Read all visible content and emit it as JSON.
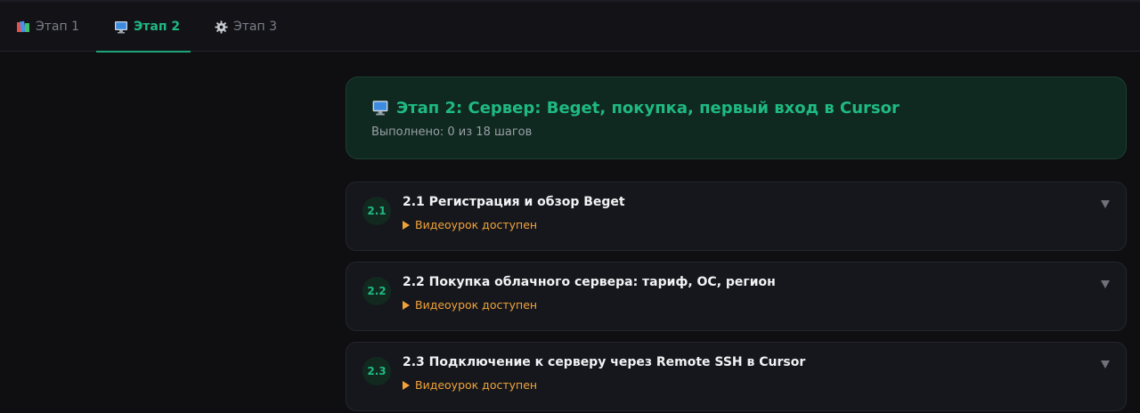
{
  "tabs": [
    {
      "label": "Этап 1",
      "icon": "books-icon",
      "active": false
    },
    {
      "label": "Этап 2",
      "icon": "desktop-computer-icon",
      "active": true
    },
    {
      "label": "Этап 3",
      "icon": "gear-icon",
      "active": false
    }
  ],
  "stage": {
    "title": "Этап 2: Сервер: Beget, покупка, первый вход в Cursor",
    "progress_text": "Выполнено: 0 из 18 шагов",
    "icon": "desktop-computer-icon"
  },
  "steps": [
    {
      "num": "2.1",
      "title": "2.1 Регистрация и обзор Beget",
      "video": "Видеоурок доступен"
    },
    {
      "num": "2.2",
      "title": "2.2 Покупка облачного сервера: тариф, ОС, регион",
      "video": "Видеоурок доступен"
    },
    {
      "num": "2.3",
      "title": "2.3 Подключение к серверу через Remote SSH в Cursor",
      "video": "Видеоурок доступен"
    }
  ],
  "colors": {
    "accent": "#1fb982",
    "video": "#f0a33a",
    "background": "#0f0f12"
  }
}
